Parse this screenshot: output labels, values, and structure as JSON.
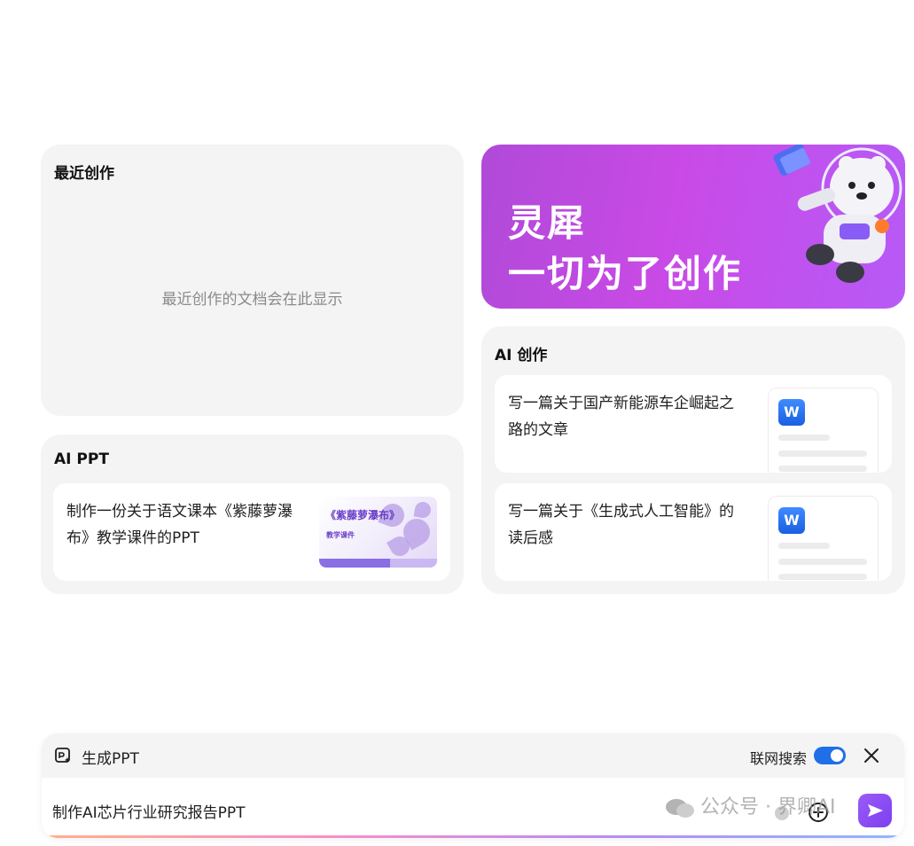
{
  "recent": {
    "title": "最近创作",
    "empty_text": "最近创作的文档会在此显示"
  },
  "ai_ppt": {
    "title": "AI PPT",
    "item_text": "制作一份关于语文课本《紫藤萝瀑布》教学课件的PPT",
    "thumb_title": "《紫藤萝瀑布》",
    "thumb_subtitle": "教学课件"
  },
  "banner": {
    "line1": "灵犀",
    "line2": "一切为了创作"
  },
  "ai_create": {
    "title": "AI 创作",
    "items": [
      {
        "text": "写一篇关于国产新能源车企崛起之路的文章",
        "icon_letter": "W"
      },
      {
        "text": "写一篇关于《生成式人工智能》的读后感",
        "icon_letter": "W"
      }
    ]
  },
  "input_bar": {
    "mode_label": "生成PPT",
    "search_label": "联网搜索",
    "search_enabled": true,
    "input_value": "制作AI芯片行业研究报告PPT"
  },
  "watermark": {
    "text": "公众号 · 界卿AI"
  },
  "colors": {
    "accent_blue": "#1f6fe8",
    "banner_purple": "#c94ae6",
    "send_purple": "#7b3ff0"
  }
}
